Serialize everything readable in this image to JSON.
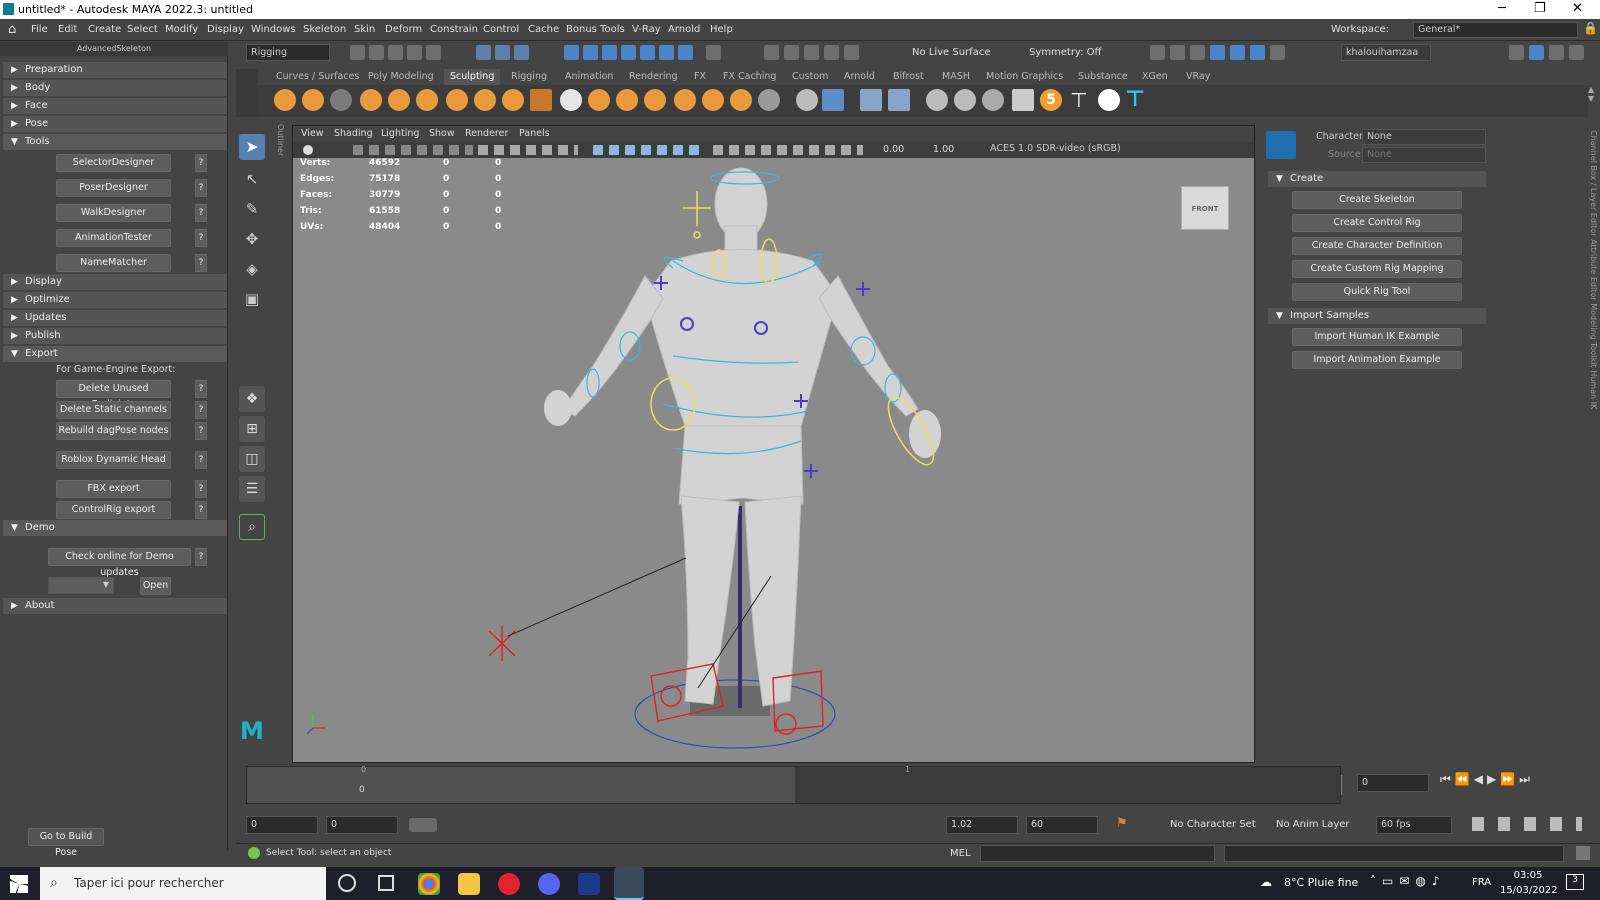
{
  "window": {
    "title": "untitled* - Autodesk MAYA 2022.3: untitled",
    "minimize": "─",
    "maximize": "❐",
    "close": "✕"
  },
  "menubar": {
    "items": [
      "File",
      "Edit",
      "Create",
      "Select",
      "Modify",
      "Display",
      "Windows",
      "Skeleton",
      "Skin",
      "Deform",
      "Constrain",
      "Control",
      "Cache",
      "Bonus Tools",
      "V-Ray",
      "Arnold",
      "Help"
    ],
    "workspace_label": "Workspace:",
    "workspace_value": "General*"
  },
  "statusline": {
    "mode": "Rigging",
    "live_surface": "No Live Surface",
    "symmetry": "Symmetry: Off",
    "user": "khalouihamzaa"
  },
  "shelf": {
    "tabs": [
      "Curves / Surfaces",
      "Poly Modeling",
      "Sculpting",
      "Rigging",
      "Animation",
      "Rendering",
      "FX",
      "FX Caching",
      "Custom",
      "Arnold",
      "Bifrost",
      "MASH",
      "Motion Graphics",
      "Substance",
      "XGen",
      "VRay"
    ],
    "active_tab": "Sculpting",
    "number_badge": "5"
  },
  "left_panel": {
    "header": "AdvancedSkeleton",
    "sections": {
      "preparation": "Preparation",
      "body": "Body",
      "face": "Face",
      "pose": "Pose",
      "tools": "Tools",
      "display": "Display",
      "optimize": "Optimize",
      "updates": "Updates",
      "publish": "Publish",
      "export": "Export",
      "demo": "Demo",
      "about": "About"
    },
    "tools_buttons": [
      "SelectorDesigner",
      "PoserDesigner",
      "WalkDesigner",
      "AnimationTester",
      "NameMatcher"
    ],
    "export_note": "For Game-Engine Export:",
    "export_buttons": [
      "Delete Unused Endjoints",
      "Delete Static channels",
      "Rebuild dagPose nodes",
      "Roblox Dynamic Head",
      "FBX export",
      "ControlRig export"
    ],
    "help_label": "?",
    "demo_button": "Check online for Demo updates",
    "open_button": "Open",
    "build_pose_button": "Go to Build Pose"
  },
  "outliner_label": "Outliner",
  "viewport": {
    "menu": [
      "View",
      "Shading",
      "Lighting",
      "Show",
      "Renderer",
      "Panels"
    ],
    "exposure": "0.00",
    "gamma": "1.00",
    "color_space": "ACES 1.0 SDR-video (sRGB)",
    "hud": [
      {
        "label": "Verts:",
        "a": "46592",
        "b": "0",
        "c": "0"
      },
      {
        "label": "Edges:",
        "a": "75178",
        "b": "0",
        "c": "0"
      },
      {
        "label": "Faces:",
        "a": "30779",
        "b": "0",
        "c": "0"
      },
      {
        "label": "Tris:",
        "a": "61558",
        "b": "0",
        "c": "0"
      },
      {
        "label": "UVs:",
        "a": "48404",
        "b": "0",
        "c": "0"
      }
    ],
    "viewcube_label": "FRONT"
  },
  "hik_panel": {
    "character_label": "Character:",
    "character_value": "None",
    "source_label": "Source:",
    "source_value": "None",
    "create_section": "Create",
    "create_buttons": [
      "Create Skeleton",
      "Create Control Rig",
      "Create Character Definition",
      "Create Custom Rig Mapping",
      "Quick Rig Tool"
    ],
    "import_section": "Import Samples",
    "import_buttons": [
      "Import Human IK Example",
      "Import Animation Example"
    ]
  },
  "right_strip": "Channel Box / Layer Editor   Attribute Editor   Modeling Toolkit   Human IK",
  "timeline": {
    "tick_0": "0",
    "tick_1": "1",
    "current_label": "0",
    "current_frame": "0"
  },
  "range": {
    "start": "0",
    "anim_start": "0",
    "anim_end": "1.02",
    "end": "60",
    "character_set": "No Character Set",
    "anim_layer": "No Anim Layer",
    "fps": "60 fps"
  },
  "command": {
    "help": "Select Tool: select an object",
    "mel_label": "MEL"
  },
  "taskbar": {
    "search_placeholder": "Taper ici pour rechercher",
    "weather": "8°C Pluie fine",
    "lang": "FRA",
    "time": "03:05",
    "date": "15/03/2022",
    "notifications": "3"
  }
}
